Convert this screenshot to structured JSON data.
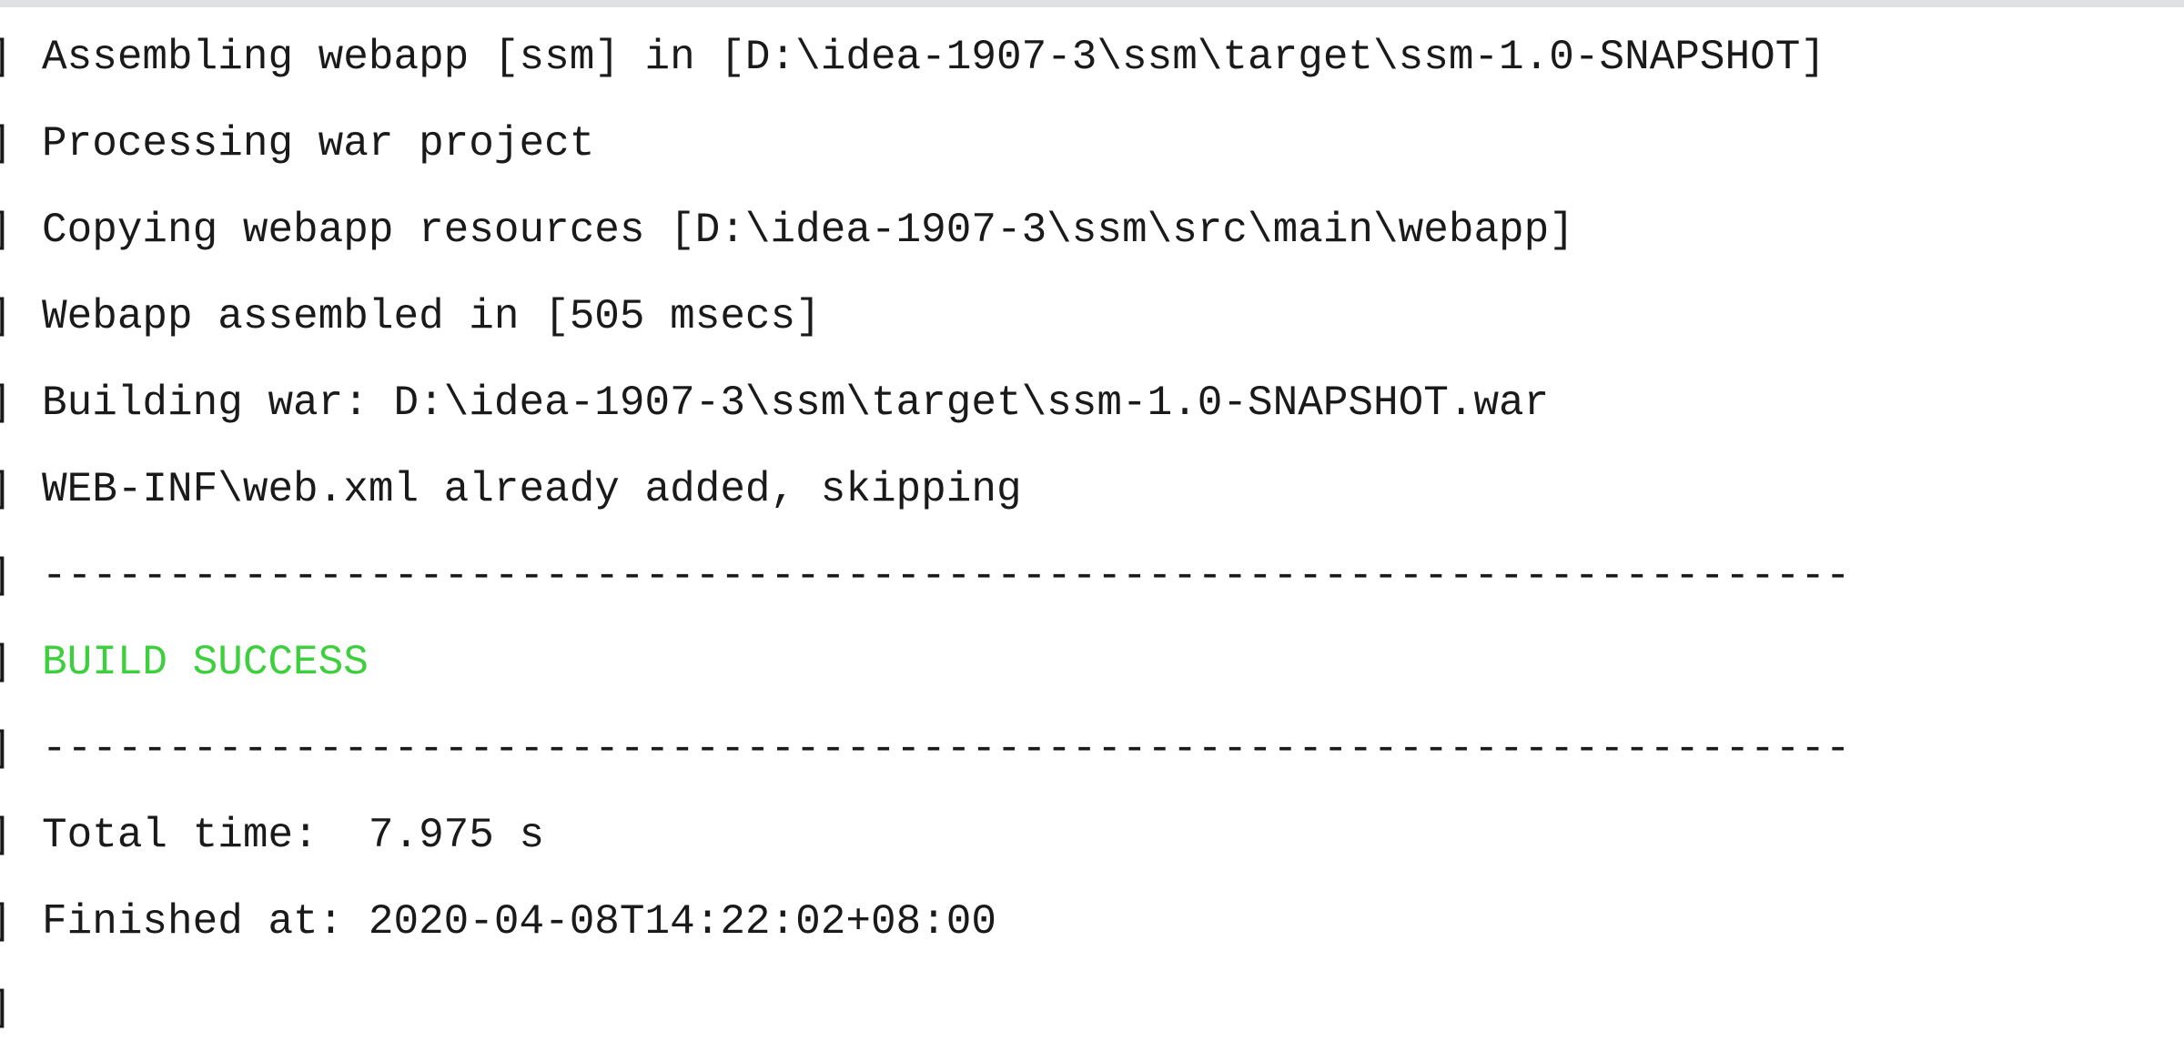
{
  "console": {
    "bracket": "]",
    "lines": [
      {
        "text": "Assembling webapp [ssm] in [D:\\idea-1907-3\\ssm\\target\\ssm-1.0-SNAPSHOT]"
      },
      {
        "text": "Processing war project"
      },
      {
        "text": "Copying webapp resources [D:\\idea-1907-3\\ssm\\src\\main\\webapp]"
      },
      {
        "text": "Webapp assembled in [505 msecs]"
      },
      {
        "text": "Building war: D:\\idea-1907-3\\ssm\\target\\ssm-1.0-SNAPSHOT.war"
      },
      {
        "text": "WEB-INF\\web.xml already added, skipping"
      },
      {
        "text": "------------------------------------------------------------------------"
      },
      {
        "text": "BUILD SUCCESS",
        "status": "success"
      },
      {
        "text": "------------------------------------------------------------------------"
      },
      {
        "text": "Total time:  7.975 s"
      },
      {
        "text": "Finished at: 2020-04-08T14:22:02+08:00"
      },
      {
        "text": ""
      }
    ]
  },
  "colors": {
    "success": "#3dcf3d",
    "text": "#1a1a1a"
  }
}
